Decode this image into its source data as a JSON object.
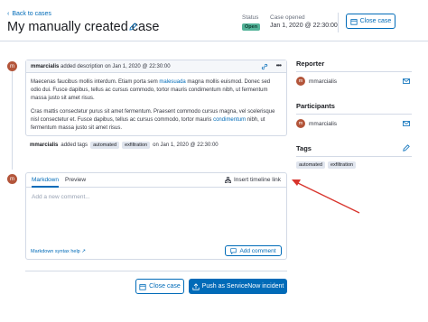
{
  "header": {
    "back_label": "Back to cases",
    "title": "My manually created case",
    "status_label": "Status",
    "status_value": "Open",
    "opened_label": "Case opened",
    "opened_value": "Jan 1, 2020 @ 22:30:00",
    "close_case_label": "Close case"
  },
  "comment": {
    "avatar_letter": "m",
    "user": "mmarcialis",
    "action": "added description on Jan 1, 2020 @ 22:30:00",
    "para1_a": "Maecenas faucibus mollis interdum. Etiam porta sem ",
    "para1_link": "malesuada",
    "para1_b": " magna mollis euismod. Donec sed odio dui. Fusce dapibus, tellus ac cursus commodo, tortor mauris condimentum nibh, ut fermentum massa justo sit amet risus.",
    "para2_a": "Cras mattis consectetur purus sit amet fermentum. Praesent commodo cursus magna, vel scelerisque nisl consectetur et. Fusce dapibus, tellus ac cursus commodo, tortor mauris ",
    "para2_link": "condimentum",
    "para2_b": " nibh, ut fermentum massa justo sit amet risus."
  },
  "tags_event": {
    "user": "mmarcialis",
    "action": "added tags",
    "tags": [
      "automated",
      "exfiltration"
    ],
    "when": "on Jan 1, 2020 @ 22:30:00"
  },
  "editor": {
    "tab_markdown": "Markdown",
    "tab_preview": "Preview",
    "insert_link": "Insert timeline link",
    "placeholder": "Add a new comment...",
    "markdown_help": "Markdown syntax help",
    "add_comment": "Add comment"
  },
  "footer": {
    "close_case": "Close case",
    "push": "Push as ServiceNow incident"
  },
  "sidebar": {
    "reporter_title": "Reporter",
    "reporter_name": "mmarcialis",
    "participants_title": "Participants",
    "participant_name": "mmarcialis",
    "tags_title": "Tags",
    "tags": [
      "automated",
      "exfiltration"
    ]
  },
  "colors": {
    "accent": "#006bb8",
    "status_open": "#54b399",
    "avatar": "#b3553a",
    "annotation_arrow": "#d8342c"
  }
}
